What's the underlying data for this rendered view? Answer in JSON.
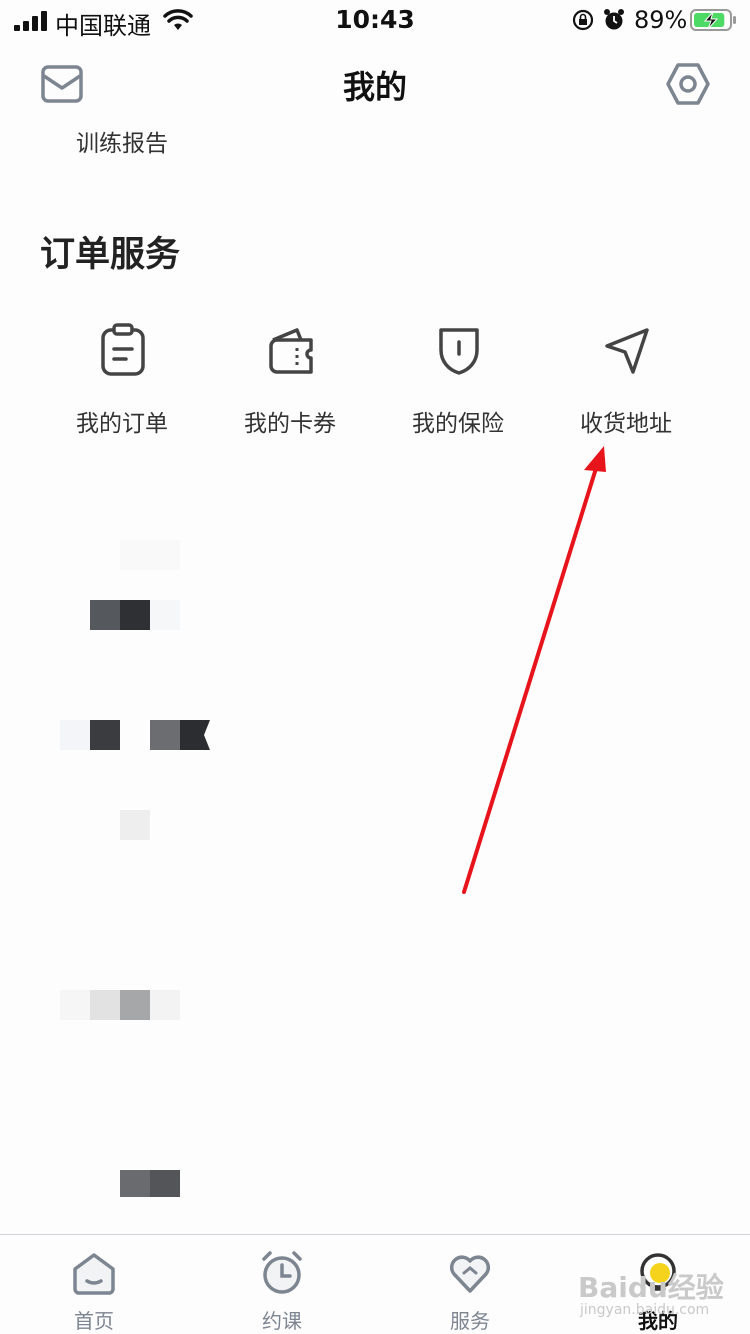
{
  "status_bar": {
    "carrier": "中国联通",
    "time": "10:43",
    "battery_percent": "89%",
    "battery_level": 0.89,
    "icons": [
      "signal-icon",
      "wifi-icon",
      "rotation-lock-icon",
      "alarm-icon",
      "battery-charging-icon"
    ]
  },
  "header": {
    "title": "我的",
    "left_icon": "mail-icon",
    "right_icon": "settings-icon"
  },
  "training_report": "训练报告",
  "order_service": {
    "title": "订单服务",
    "items": [
      {
        "label": "我的订单",
        "icon": "clipboard-icon"
      },
      {
        "label": "我的卡券",
        "icon": "wallet-icon"
      },
      {
        "label": "我的保险",
        "icon": "shield-icon"
      },
      {
        "label": "收货地址",
        "icon": "navigation-arrow-icon"
      }
    ]
  },
  "annotation": {
    "color": "#e8141b"
  },
  "tab_bar": {
    "tabs": [
      {
        "label": "首页",
        "icon": "home-icon",
        "active": false
      },
      {
        "label": "约课",
        "icon": "alarm-clock-icon",
        "active": false
      },
      {
        "label": "服务",
        "icon": "heart-icon",
        "active": false
      },
      {
        "label": "我的",
        "icon": "profile-bulb-icon",
        "active": true
      }
    ]
  },
  "watermark": {
    "logo": "Baidu经验",
    "url": "jingyan.baidu.com"
  },
  "colors": {
    "icon_gray": "#7d8590",
    "text_dark": "#222222",
    "active_yellow": "#f5d31c"
  }
}
